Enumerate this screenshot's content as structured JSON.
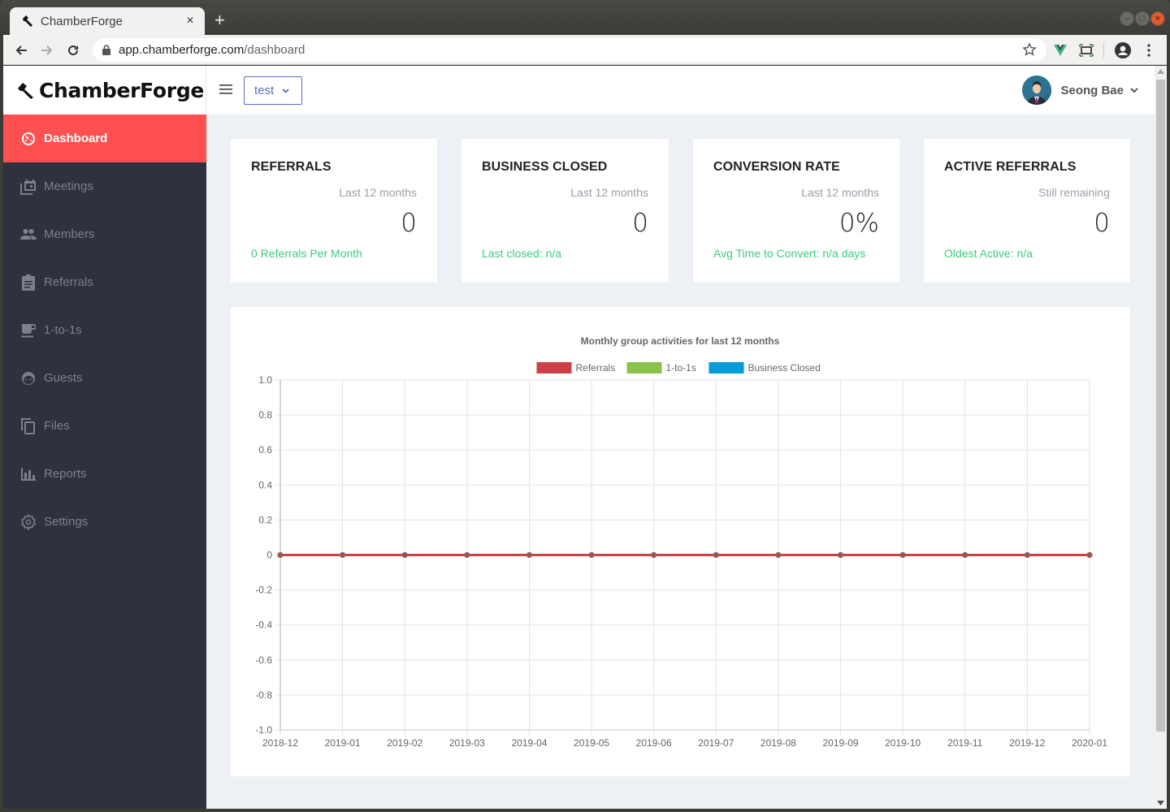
{
  "browser": {
    "tab_title": "ChamberForge",
    "url_host": "app.chamberforge.com",
    "url_path": "/dashboard",
    "tab_close": "×",
    "new_tab": "+"
  },
  "app": {
    "brand": "ChamberForge",
    "group_select": "test",
    "user_name": "Seong Bae"
  },
  "sidebar": {
    "items": [
      {
        "label": "Dashboard",
        "icon": "dashboard-icon",
        "active": true
      },
      {
        "label": "Meetings",
        "icon": "meetings-icon"
      },
      {
        "label": "Members",
        "icon": "members-icon"
      },
      {
        "label": "Referrals",
        "icon": "referrals-icon"
      },
      {
        "label": "1-to-1s",
        "icon": "coffee-icon"
      },
      {
        "label": "Guests",
        "icon": "guest-face-icon"
      },
      {
        "label": "Files",
        "icon": "files-icon"
      },
      {
        "label": "Reports",
        "icon": "reports-icon"
      },
      {
        "label": "Settings",
        "icon": "settings-icon"
      }
    ]
  },
  "cards": [
    {
      "title": "REFERRALS",
      "subtitle": "Last 12 months",
      "value": "0",
      "footer": "0 Referrals Per Month"
    },
    {
      "title": "BUSINESS CLOSED",
      "subtitle": "Last 12 months",
      "value": "0",
      "footer": "Last closed: n/a"
    },
    {
      "title": "CONVERSION RATE",
      "subtitle": "Last 12 months",
      "value": "0%",
      "footer": "Avg Time to Convert: n/a days"
    },
    {
      "title": "ACTIVE REFERRALS",
      "subtitle": "Still remaining",
      "value": "0",
      "footer": "Oldest Active: n/a"
    }
  ],
  "colors": {
    "accent": "#fe5050",
    "sidebar_bg": "#2f323e",
    "positive": "#3ccc7e",
    "select": "#5c6bc0"
  },
  "chart_data": {
    "type": "line",
    "title": "Monthly group activities for last 12 months",
    "legend_position": "top",
    "x": [
      "2018-12",
      "2019-01",
      "2019-02",
      "2019-03",
      "2019-04",
      "2019-05",
      "2019-06",
      "2019-07",
      "2019-08",
      "2019-09",
      "2019-10",
      "2019-11",
      "2019-12",
      "2020-01"
    ],
    "series": [
      {
        "name": "Referrals",
        "color": "#cc4146",
        "values": [
          0,
          0,
          0,
          0,
          0,
          0,
          0,
          0,
          0,
          0,
          0,
          0,
          0,
          0
        ]
      },
      {
        "name": "1-to-1s",
        "color": "#8bc34a",
        "values": [
          0,
          0,
          0,
          0,
          0,
          0,
          0,
          0,
          0,
          0,
          0,
          0,
          0,
          0
        ]
      },
      {
        "name": "Business Closed",
        "color": "#039bd8",
        "values": [
          0,
          0,
          0,
          0,
          0,
          0,
          0,
          0,
          0,
          0,
          0,
          0,
          0,
          0
        ]
      }
    ],
    "ylim": [
      -1.0,
      1.0
    ],
    "yticks": [
      "1.0",
      "0.8",
      "0.6",
      "0.4",
      "0.2",
      "0",
      "-0.2",
      "-0.4",
      "-0.6",
      "-0.8",
      "-1.0"
    ],
    "grid": true,
    "xlabel": "",
    "ylabel": ""
  }
}
